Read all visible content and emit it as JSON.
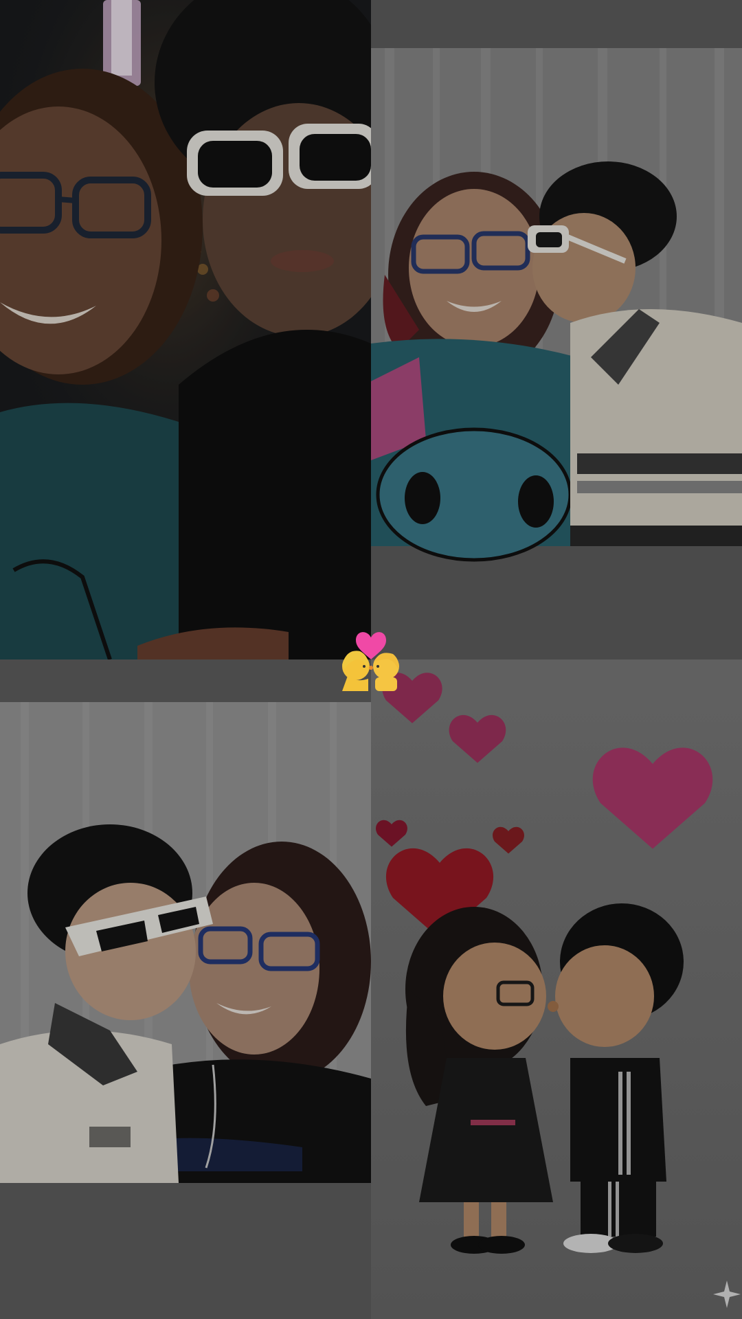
{
  "collage": {
    "tiles": [
      {
        "id": "top-left",
        "scene": "night-selfie"
      },
      {
        "id": "top-right",
        "scene": "photobooth-kiss"
      },
      {
        "id": "bottom-left",
        "scene": "photobooth-hug"
      },
      {
        "id": "bottom-right",
        "scene": "illustrated-kiss"
      }
    ],
    "center_sticker": {
      "icon": "kiss-couple-emoji-icon"
    },
    "corner_mark": {
      "icon": "sparkle-icon"
    }
  },
  "colors": {
    "heart_pink": "#c23b73",
    "heart_red": "#b01f2c",
    "teal_shirt": "#2d7d8b",
    "sunglasses_frame": "#f2f0ea"
  }
}
